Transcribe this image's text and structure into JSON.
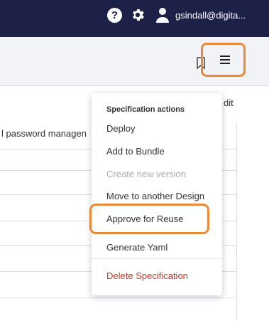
{
  "topbar": {
    "help_label": "?",
    "user_email": "gsindall@digita..."
  },
  "page": {
    "column_fragment": "dit",
    "row_text": "l password managen"
  },
  "menu": {
    "header": "Specification actions",
    "items": [
      {
        "label": "Deploy",
        "state": "enabled"
      },
      {
        "label": "Add to Bundle",
        "state": "enabled"
      },
      {
        "label": "Create new version",
        "state": "disabled"
      },
      {
        "label": "Move to another Design",
        "state": "enabled"
      },
      {
        "label": "Approve for Reuse",
        "state": "highlighted"
      },
      {
        "label": "Generate Yaml",
        "state": "enabled"
      },
      {
        "label": "Delete Specification",
        "state": "danger"
      }
    ]
  },
  "colors": {
    "topbar_bg": "#1d2047",
    "highlight": "#e98a3a",
    "danger": "#c0392b"
  },
  "icons": [
    "help-icon",
    "gear-icon",
    "user-icon",
    "bookmark-icon",
    "hamburger-menu-icon"
  ]
}
